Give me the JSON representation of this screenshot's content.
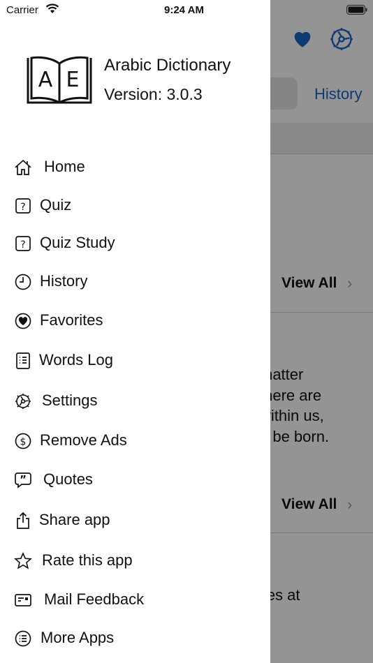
{
  "status_bar": {
    "carrier": "Carrier",
    "time": "9:24 AM"
  },
  "drawer": {
    "app_name": "Arabic Dictionary",
    "version": "Version: 3.0.3",
    "logo_letters": [
      "A",
      "E"
    ],
    "menu": [
      {
        "label": "Home",
        "icon": "home-icon"
      },
      {
        "label": "Quiz",
        "icon": "question-square-icon"
      },
      {
        "label": "Quiz Study",
        "icon": "question-square-icon"
      },
      {
        "label": "History",
        "icon": "clock-icon"
      },
      {
        "label": "Favorites",
        "icon": "heart-circle-icon"
      },
      {
        "label": "Words Log",
        "icon": "list-doc-icon"
      },
      {
        "label": "Settings",
        "icon": "gear-icon"
      },
      {
        "label": "Remove Ads",
        "icon": "dollar-circle-icon"
      },
      {
        "label": "Quotes",
        "icon": "quote-bubble-icon"
      },
      {
        "label": "Share app",
        "icon": "share-icon"
      },
      {
        "label": "Rate this app",
        "icon": "star-icon"
      },
      {
        "label": "Mail Feedback",
        "icon": "mail-card-icon"
      },
      {
        "label": "More Apps",
        "icon": "list-circle-icon"
      }
    ]
  },
  "background": {
    "history_link": "History",
    "view_all_1": "View All",
    "view_all_2": "View All",
    "quote_text": "matter\nthere are\nwithin us,\no be born.",
    "quote_text_2": "iles at",
    "chevron": "›"
  },
  "colors": {
    "accent": "#1a62c6",
    "dim_overlay": "rgba(0,0,0,0.42)"
  }
}
